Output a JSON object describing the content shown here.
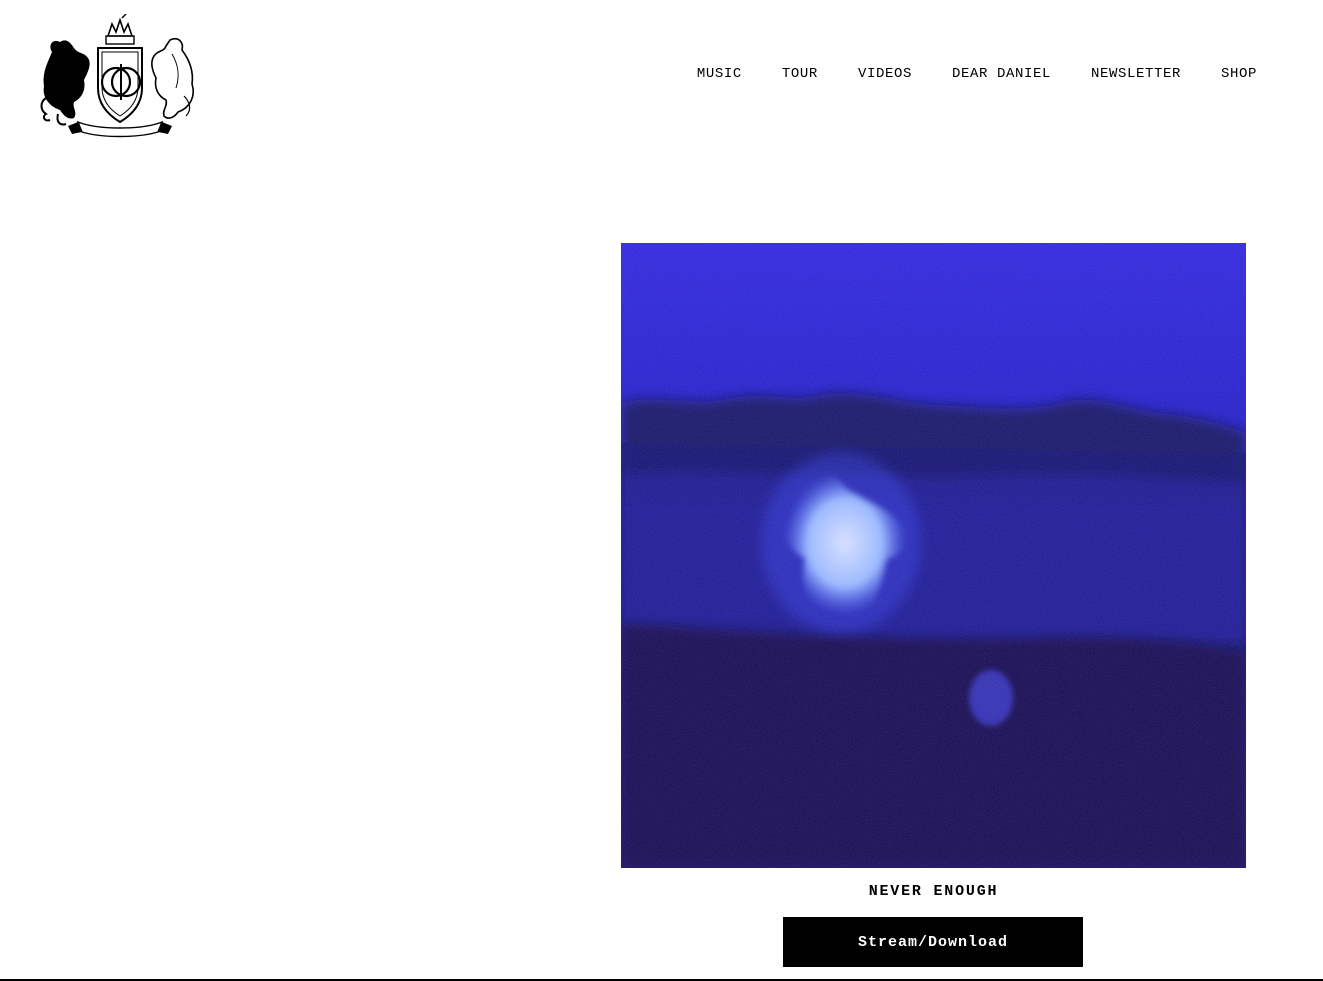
{
  "header": {
    "logo_icon": "heraldic-crest-logo",
    "nav": [
      {
        "label": "MUSIC"
      },
      {
        "label": "TOUR"
      },
      {
        "label": "VIDEOS"
      },
      {
        "label": "DEAR DANIEL"
      },
      {
        "label": "NEWSLETTER"
      },
      {
        "label": "SHOP"
      }
    ]
  },
  "release": {
    "cover_icon": "album-cover-art",
    "title": "NEVER ENOUGH",
    "button_label": "Stream/Download"
  },
  "colors": {
    "background": "#ffffff",
    "text": "#000000",
    "button_bg": "#000000",
    "button_text": "#ffffff",
    "cover_blue": "#1a14b8"
  }
}
